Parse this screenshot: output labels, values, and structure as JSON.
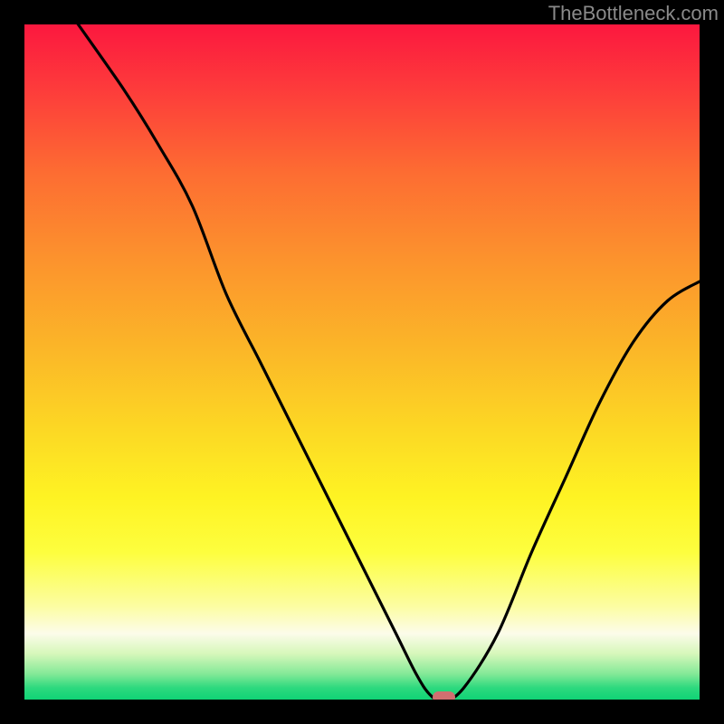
{
  "watermark": "TheBottleneck.com",
  "colors": {
    "background": "#000000",
    "curve_stroke": "#000000",
    "marker_fill": "#d06f70",
    "gradient_top": "#fc173f",
    "gradient_bottom": "#0bd274"
  },
  "chart_data": {
    "type": "line",
    "title": "",
    "xlabel": "",
    "ylabel": "",
    "xlim": [
      0,
      100
    ],
    "ylim": [
      0,
      100
    ],
    "x": [
      8,
      15,
      20,
      25,
      30,
      35,
      40,
      45,
      50,
      55,
      58,
      60,
      62,
      65,
      70,
      75,
      80,
      85,
      90,
      95,
      100
    ],
    "values": [
      100,
      90,
      82,
      73,
      60,
      50,
      40,
      30,
      20,
      10,
      4,
      1,
      0,
      2,
      10,
      22,
      33,
      44,
      53,
      59,
      62
    ],
    "minimum": {
      "x": 62,
      "y": 0
    },
    "background_encoding": "vertical gradient, red (high y) through orange/yellow to green (low y)",
    "notes": "No axis ticks or numeric labels are visible on the image; x and y values are gridline-estimated percentages of the plot extent."
  }
}
